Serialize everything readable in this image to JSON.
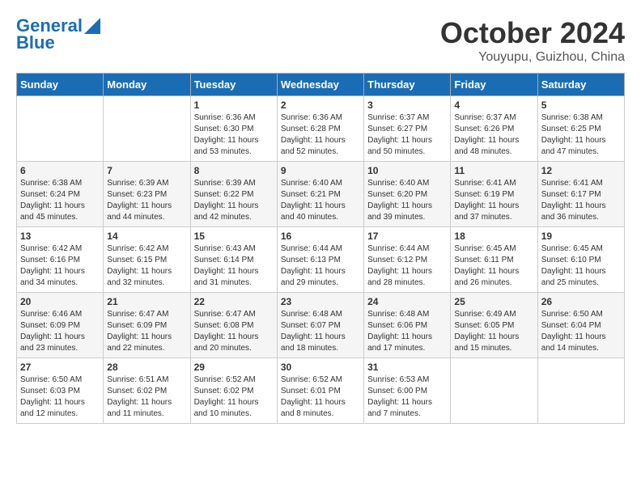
{
  "header": {
    "logo_line1": "General",
    "logo_line2": "Blue",
    "title": "October 2024",
    "subtitle": "Youyupu, Guizhou, China"
  },
  "days_of_week": [
    "Sunday",
    "Monday",
    "Tuesday",
    "Wednesday",
    "Thursday",
    "Friday",
    "Saturday"
  ],
  "weeks": [
    [
      {
        "day": "",
        "info": ""
      },
      {
        "day": "",
        "info": ""
      },
      {
        "day": "1",
        "info": "Sunrise: 6:36 AM\nSunset: 6:30 PM\nDaylight: 11 hours\nand 53 minutes."
      },
      {
        "day": "2",
        "info": "Sunrise: 6:36 AM\nSunset: 6:28 PM\nDaylight: 11 hours\nand 52 minutes."
      },
      {
        "day": "3",
        "info": "Sunrise: 6:37 AM\nSunset: 6:27 PM\nDaylight: 11 hours\nand 50 minutes."
      },
      {
        "day": "4",
        "info": "Sunrise: 6:37 AM\nSunset: 6:26 PM\nDaylight: 11 hours\nand 48 minutes."
      },
      {
        "day": "5",
        "info": "Sunrise: 6:38 AM\nSunset: 6:25 PM\nDaylight: 11 hours\nand 47 minutes."
      }
    ],
    [
      {
        "day": "6",
        "info": "Sunrise: 6:38 AM\nSunset: 6:24 PM\nDaylight: 11 hours\nand 45 minutes."
      },
      {
        "day": "7",
        "info": "Sunrise: 6:39 AM\nSunset: 6:23 PM\nDaylight: 11 hours\nand 44 minutes."
      },
      {
        "day": "8",
        "info": "Sunrise: 6:39 AM\nSunset: 6:22 PM\nDaylight: 11 hours\nand 42 minutes."
      },
      {
        "day": "9",
        "info": "Sunrise: 6:40 AM\nSunset: 6:21 PM\nDaylight: 11 hours\nand 40 minutes."
      },
      {
        "day": "10",
        "info": "Sunrise: 6:40 AM\nSunset: 6:20 PM\nDaylight: 11 hours\nand 39 minutes."
      },
      {
        "day": "11",
        "info": "Sunrise: 6:41 AM\nSunset: 6:19 PM\nDaylight: 11 hours\nand 37 minutes."
      },
      {
        "day": "12",
        "info": "Sunrise: 6:41 AM\nSunset: 6:17 PM\nDaylight: 11 hours\nand 36 minutes."
      }
    ],
    [
      {
        "day": "13",
        "info": "Sunrise: 6:42 AM\nSunset: 6:16 PM\nDaylight: 11 hours\nand 34 minutes."
      },
      {
        "day": "14",
        "info": "Sunrise: 6:42 AM\nSunset: 6:15 PM\nDaylight: 11 hours\nand 32 minutes."
      },
      {
        "day": "15",
        "info": "Sunrise: 6:43 AM\nSunset: 6:14 PM\nDaylight: 11 hours\nand 31 minutes."
      },
      {
        "day": "16",
        "info": "Sunrise: 6:44 AM\nSunset: 6:13 PM\nDaylight: 11 hours\nand 29 minutes."
      },
      {
        "day": "17",
        "info": "Sunrise: 6:44 AM\nSunset: 6:12 PM\nDaylight: 11 hours\nand 28 minutes."
      },
      {
        "day": "18",
        "info": "Sunrise: 6:45 AM\nSunset: 6:11 PM\nDaylight: 11 hours\nand 26 minutes."
      },
      {
        "day": "19",
        "info": "Sunrise: 6:45 AM\nSunset: 6:10 PM\nDaylight: 11 hours\nand 25 minutes."
      }
    ],
    [
      {
        "day": "20",
        "info": "Sunrise: 6:46 AM\nSunset: 6:09 PM\nDaylight: 11 hours\nand 23 minutes."
      },
      {
        "day": "21",
        "info": "Sunrise: 6:47 AM\nSunset: 6:09 PM\nDaylight: 11 hours\nand 22 minutes."
      },
      {
        "day": "22",
        "info": "Sunrise: 6:47 AM\nSunset: 6:08 PM\nDaylight: 11 hours\nand 20 minutes."
      },
      {
        "day": "23",
        "info": "Sunrise: 6:48 AM\nSunset: 6:07 PM\nDaylight: 11 hours\nand 18 minutes."
      },
      {
        "day": "24",
        "info": "Sunrise: 6:48 AM\nSunset: 6:06 PM\nDaylight: 11 hours\nand 17 minutes."
      },
      {
        "day": "25",
        "info": "Sunrise: 6:49 AM\nSunset: 6:05 PM\nDaylight: 11 hours\nand 15 minutes."
      },
      {
        "day": "26",
        "info": "Sunrise: 6:50 AM\nSunset: 6:04 PM\nDaylight: 11 hours\nand 14 minutes."
      }
    ],
    [
      {
        "day": "27",
        "info": "Sunrise: 6:50 AM\nSunset: 6:03 PM\nDaylight: 11 hours\nand 12 minutes."
      },
      {
        "day": "28",
        "info": "Sunrise: 6:51 AM\nSunset: 6:02 PM\nDaylight: 11 hours\nand 11 minutes."
      },
      {
        "day": "29",
        "info": "Sunrise: 6:52 AM\nSunset: 6:02 PM\nDaylight: 11 hours\nand 10 minutes."
      },
      {
        "day": "30",
        "info": "Sunrise: 6:52 AM\nSunset: 6:01 PM\nDaylight: 11 hours\nand 8 minutes."
      },
      {
        "day": "31",
        "info": "Sunrise: 6:53 AM\nSunset: 6:00 PM\nDaylight: 11 hours\nand 7 minutes."
      },
      {
        "day": "",
        "info": ""
      },
      {
        "day": "",
        "info": ""
      }
    ]
  ]
}
